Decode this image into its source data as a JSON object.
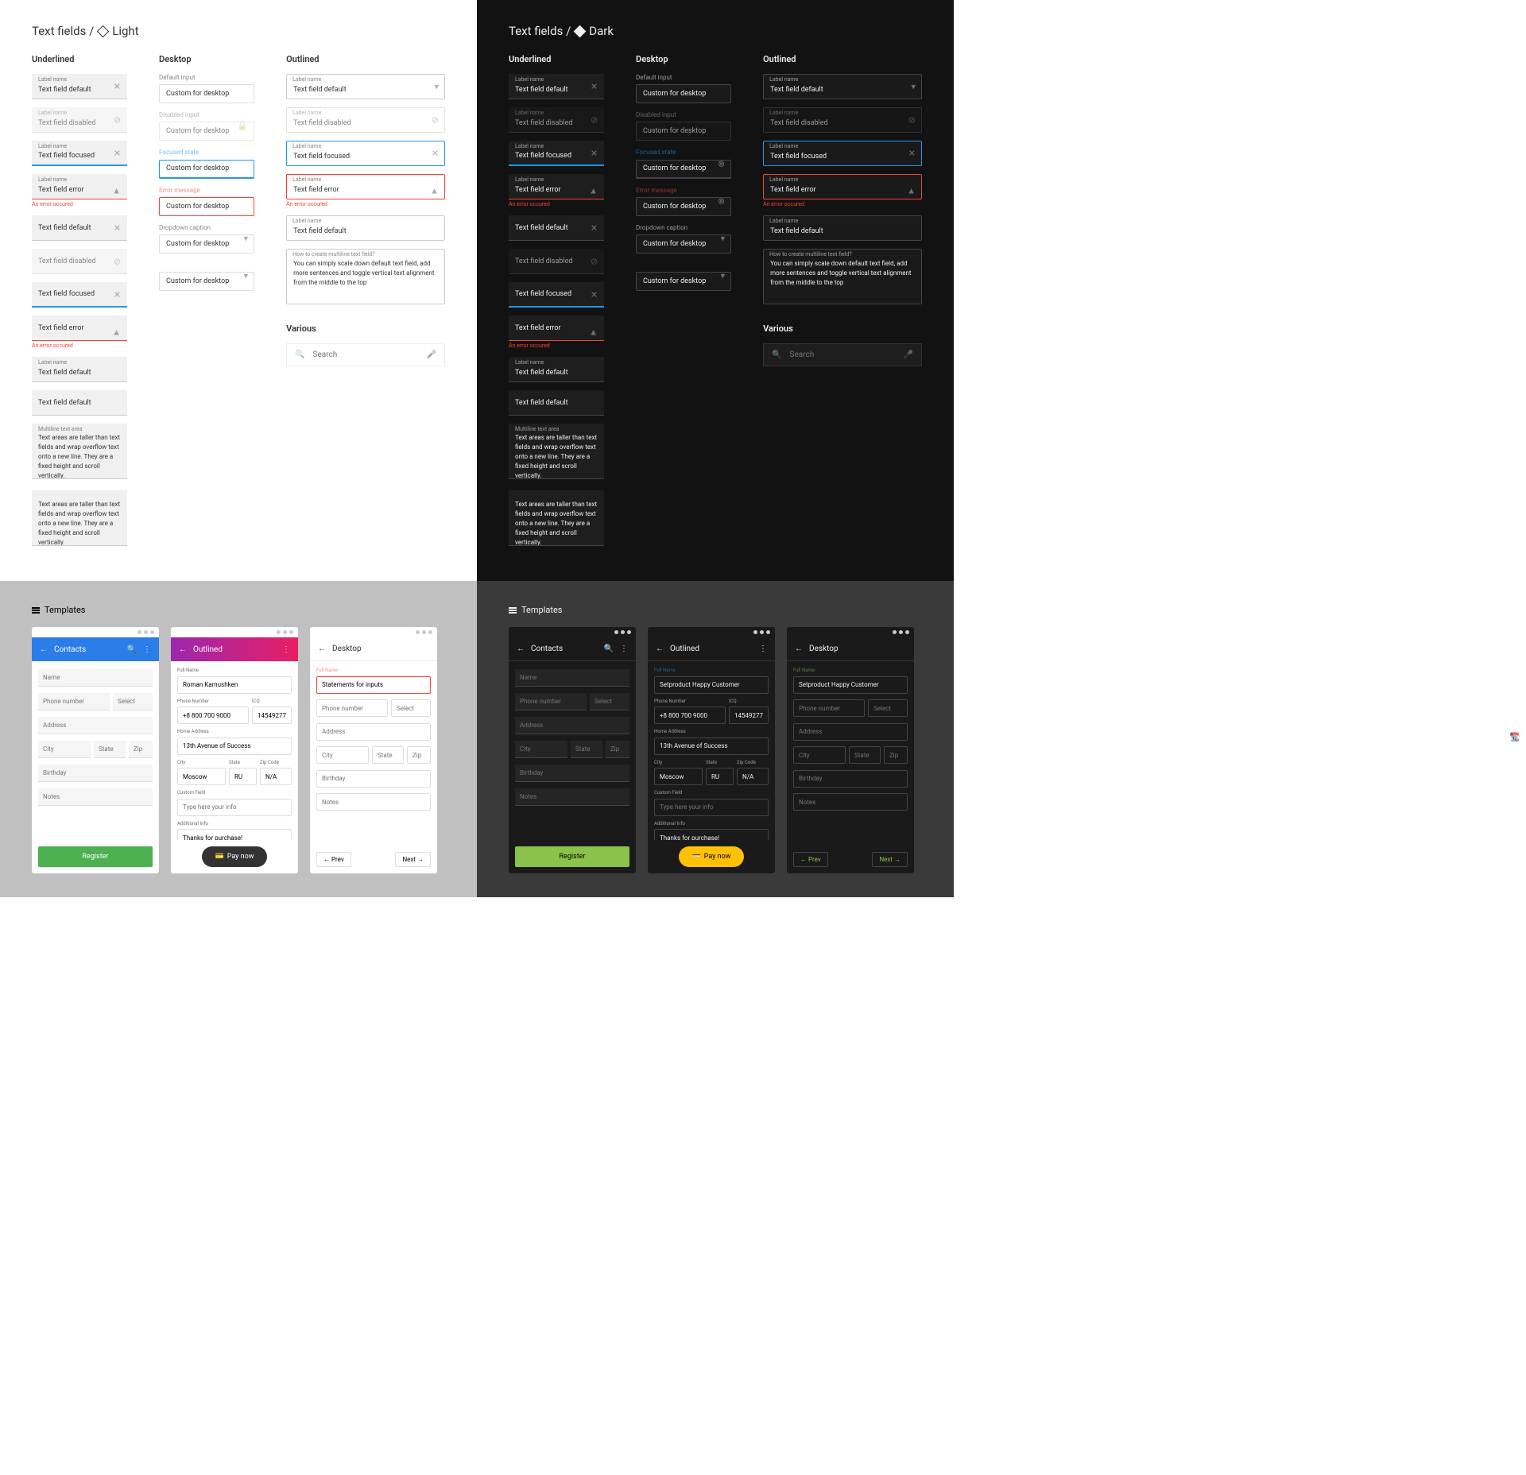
{
  "pageTitle": {
    "light": "Text fields / ",
    "lightTheme": "Light",
    "dark": "Text fields / ",
    "darkTheme": "Dark"
  },
  "sections": {
    "underlined": "Underlined",
    "desktop": "Desktop",
    "outlined": "Outlined",
    "various": "Various",
    "templates": "Templates"
  },
  "labels": {
    "labelName": "Label name",
    "default": "Text field default",
    "disabled": "Text field disabled",
    "focused": "Text field focused",
    "error": "Text field error",
    "errorHelper": "An error occured",
    "defaultInput": "Default input",
    "disabledInput": "Disabled input",
    "focusedState": "Focused state",
    "errorMessage": "Error message",
    "dropdownCaption": "Dropdown caption",
    "customDesktop": "Custom for desktop",
    "multilineLabel": "Multiline text area",
    "multilineText": "Text areas are taller than text fields and wrap overflow text onto a new line. They are a fixed height and scroll vertically.",
    "howToTitle": "How to create multiline text field?",
    "howToBody": "You can simply scale down default text field, add more sentences and toggle vertical text alignment from the middle to the top",
    "search": "Search"
  },
  "tpl": {
    "contacts": "Contacts",
    "outlined": "Outlined",
    "desktop": "Desktop",
    "name": "Name",
    "fullName": "Full Name",
    "romanK": "Roman Kamushken",
    "statements": "Statements for inputs",
    "happy": "Setproduct Happy Customer",
    "phone": "Phone number",
    "phoneLabel": "Phone Number",
    "phoneVal": "+8 800 700 9000",
    "icq": "ICQ",
    "icqVal": "14549277",
    "select": "Select",
    "address": "Address",
    "homeAddr": "Home Address",
    "addrVal": "13th Avenue of Success",
    "city": "City",
    "cityVal": "Moscow",
    "state": "State",
    "stateVal": "RU",
    "zip": "Zip",
    "zipLabel": "Zip Code",
    "zipVal": "N/A",
    "birthday": "Birthday",
    "notes": "Notes",
    "customField": "Custom Field",
    "typeHere": "Type here your info",
    "addInfo": "Additional Info",
    "thanks": "Thanks for purchase!",
    "register": "Register",
    "payNow": "Pay now",
    "prev": "Prev",
    "next": "Next"
  }
}
